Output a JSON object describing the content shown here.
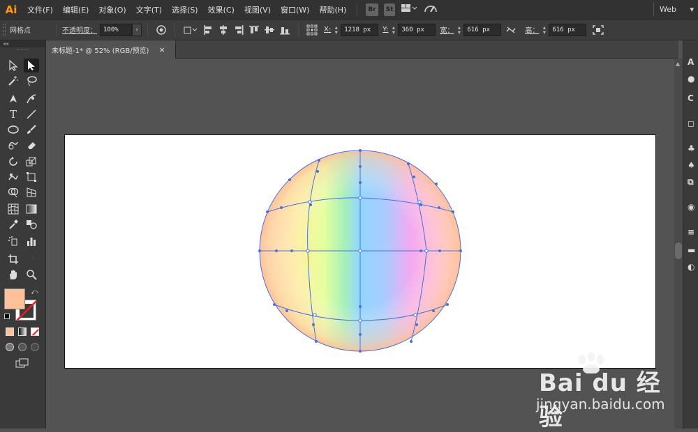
{
  "app": {
    "logo": "Ai",
    "workspace": "Web"
  },
  "menu": {
    "items": [
      "文件(F)",
      "编辑(E)",
      "对象(O)",
      "文字(T)",
      "选择(S)",
      "效果(C)",
      "视图(V)",
      "窗口(W)",
      "帮助(H)"
    ],
    "bridge_label": "Br",
    "stock_label": "St"
  },
  "control": {
    "selection_type": "网格点",
    "opacity_label": "不透明度：",
    "opacity_value": "100%",
    "x_label": "X:",
    "x_value": "1218 px",
    "y_label": "Y:",
    "y_value": "360 px",
    "w_label": "宽：",
    "w_value": "616 px",
    "h_label": "高：",
    "h_value": "616 px"
  },
  "document": {
    "tab_title": "未标题-1* @ 52% (RGB/预览)",
    "close_glyph": "×"
  },
  "tools": {
    "fill_color": "#ffc19a",
    "stroke_none": true
  },
  "watermark": {
    "brand": "Bai du 经验",
    "url": "jingyan.baidu.com"
  },
  "colors": {
    "menubar_bg": "#323232",
    "panel_bg": "#3a3a3a",
    "canvas_bg": "#535353",
    "mesh_line": "#4a6fe0"
  }
}
